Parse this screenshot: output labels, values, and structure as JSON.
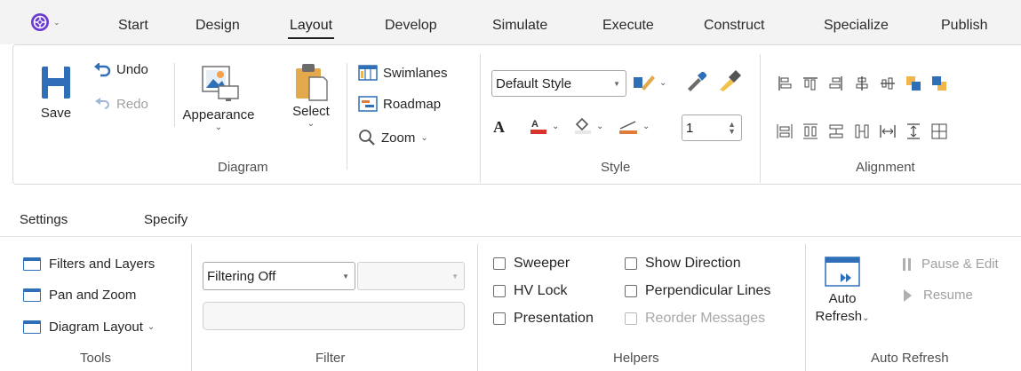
{
  "tabs": [
    "Start",
    "Design",
    "Layout",
    "Develop",
    "Simulate",
    "Execute",
    "Construct",
    "Specialize",
    "Publish"
  ],
  "active_tab": "Layout",
  "ribbon_top": {
    "save_label": "Save",
    "undo_label": "Undo",
    "redo_label": "Redo",
    "diagram": {
      "appearance_label": "Appearance",
      "select_label": "Select",
      "swimlanes_label": "Swimlanes",
      "roadmap_label": "Roadmap",
      "zoom_label": "Zoom",
      "group_label": "Diagram"
    },
    "style": {
      "style_combo_value": "Default Style",
      "line_width_value": "1",
      "group_label": "Style"
    },
    "alignment": {
      "group_label": "Alignment"
    }
  },
  "subtabs": [
    "Settings",
    "Specify"
  ],
  "ribbon_bottom": {
    "tools": {
      "items": [
        "Filters and Layers",
        "Pan and Zoom",
        "Diagram Layout"
      ],
      "group_label": "Tools"
    },
    "filter": {
      "filter_combo_value": "Filtering Off",
      "group_label": "Filter"
    },
    "helpers": {
      "sweeper_label": "Sweeper",
      "hv_lock_label": "HV Lock",
      "presentation_label": "Presentation",
      "show_direction_label": "Show Direction",
      "perpendicular_lines_label": "Perpendicular Lines",
      "reorder_messages_label": "Reorder Messages",
      "group_label": "Helpers"
    },
    "auto_refresh": {
      "auto_label": "Auto",
      "refresh_label": "Refresh",
      "pause_edit_label": "Pause & Edit",
      "resume_label": "Resume",
      "group_label": "Auto Refresh"
    }
  },
  "colors": {
    "accent_blue": "#2f6fb8",
    "ribbon_bg": "#ffffff",
    "tabbar_bg": "#f3f3f3"
  }
}
